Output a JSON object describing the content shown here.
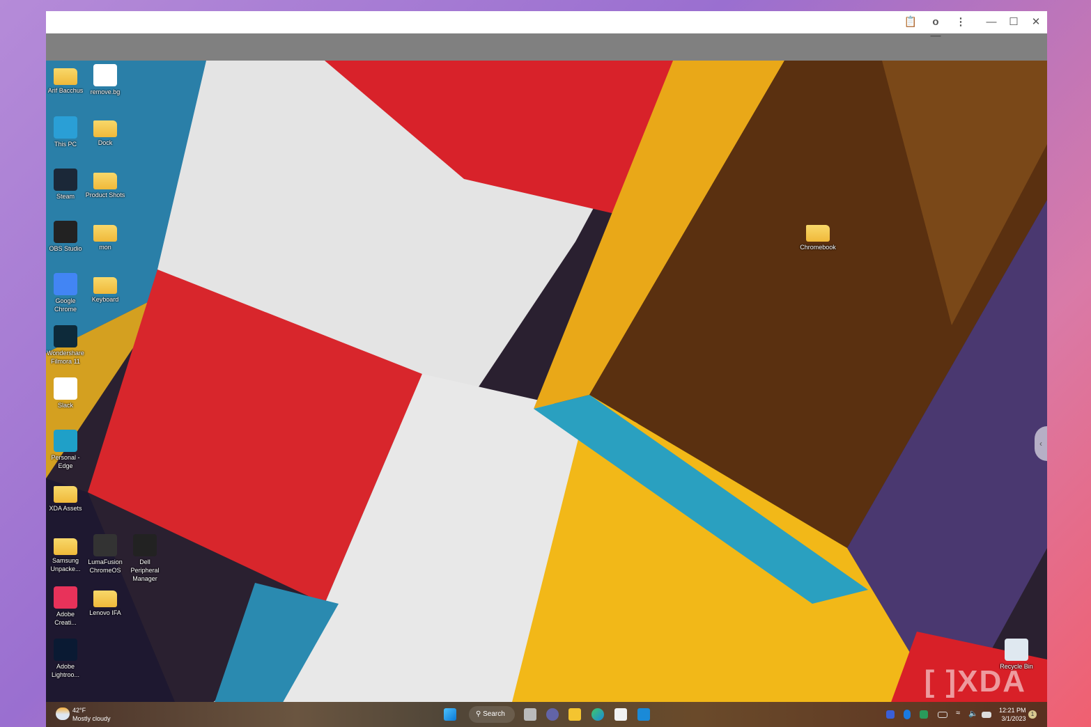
{
  "titlebar": {
    "icons": [
      "clipboard-icon",
      "key-icon",
      "more-vert-icon",
      "minimize-icon",
      "maximize-icon",
      "close-icon"
    ]
  },
  "desktop": {
    "icons": [
      {
        "label": "Arif Bacchus",
        "icon": "user-folder-icon",
        "color": "#f0b93a"
      },
      {
        "label": "remove.bg",
        "icon": "removebg-icon",
        "color": "#ffffff"
      },
      {
        "label": "This PC",
        "icon": "monitor-icon",
        "color": "#2a9fd6"
      },
      {
        "label": "Dock",
        "icon": "folder-icon",
        "color": "#f0b93a"
      },
      {
        "label": "Steam",
        "icon": "steam-icon",
        "color": "#1b2838"
      },
      {
        "label": "Product Shots",
        "icon": "folder-icon",
        "color": "#f0b93a"
      },
      {
        "label": "OBS Studio",
        "icon": "obs-icon",
        "color": "#222222"
      },
      {
        "label": "mon",
        "icon": "folder-icon",
        "color": "#f0b93a"
      },
      {
        "label": "Google Chrome",
        "icon": "chrome-icon",
        "color": "#4285f4"
      },
      {
        "label": "Keyboard",
        "icon": "folder-icon",
        "color": "#f0b93a"
      },
      {
        "label": "Wondershare Filmora 11",
        "icon": "filmora-icon",
        "color": "#0d2a3a"
      },
      {
        "label": "Slack",
        "icon": "slack-icon",
        "color": "#ffffff"
      },
      {
        "label": "Personal - Edge",
        "icon": "edge-icon",
        "color": "#1fa0c8"
      },
      {
        "label": "XDA Assets",
        "icon": "folder-icon",
        "color": "#f0b93a"
      },
      {
        "label": "Samsung Unpacke...",
        "icon": "folder-icon",
        "color": "#f0b93a"
      },
      {
        "label": "LumaFusion ChromeOS",
        "icon": "lumafusion-icon",
        "color": "#333333"
      },
      {
        "label": "Dell Peripheral Manager",
        "icon": "dell-icon",
        "color": "#222222"
      },
      {
        "label": "Adobe Creati...",
        "icon": "creative-cloud-icon",
        "color": "#e8325a"
      },
      {
        "label": "Lenovo IFA",
        "icon": "folder-icon",
        "color": "#f0b93a"
      },
      {
        "label": "Adobe Lightroo...",
        "icon": "lightroom-icon",
        "color": "#0a1a33"
      },
      {
        "label": "Chromebook",
        "icon": "folder-icon",
        "color": "#f0b93a"
      },
      {
        "label": "Recycle Bin",
        "icon": "recycle-bin-icon",
        "color": "#dfe8f0"
      }
    ]
  },
  "taskbar": {
    "weather": {
      "temp": "42°F",
      "condition": "Mostly cloudy"
    },
    "search_label": "Search",
    "time": "12:21 PM",
    "date": "3/1/2023",
    "notification_count": "1"
  },
  "watermark": "XDA"
}
